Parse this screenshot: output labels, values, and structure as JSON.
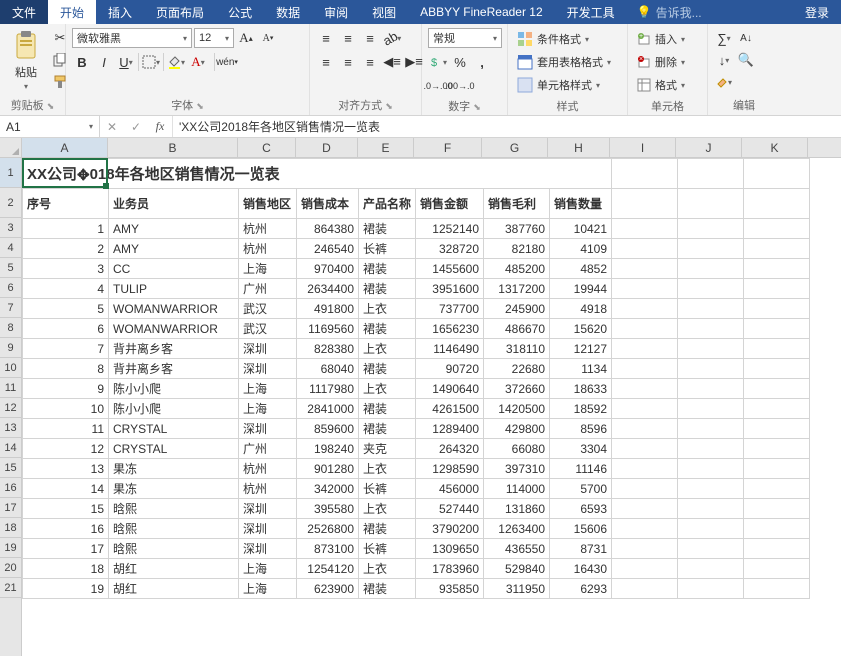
{
  "menu": {
    "file": "文件",
    "tabs": [
      "开始",
      "插入",
      "页面布局",
      "公式",
      "数据",
      "审阅",
      "视图",
      "ABBYY FineReader 12",
      "开发工具"
    ],
    "tellme": "告诉我...",
    "login": "登录"
  },
  "ribbon": {
    "clipboard": {
      "label": "剪贴板",
      "paste": "粘贴"
    },
    "font": {
      "label": "字体",
      "name": "微软雅黑",
      "size": "12"
    },
    "align": {
      "label": "对齐方式"
    },
    "number": {
      "label": "数字",
      "format": "常规"
    },
    "styles": {
      "label": "样式",
      "cond": "条件格式",
      "table": "套用表格格式",
      "cell": "单元格样式"
    },
    "cells": {
      "label": "单元格",
      "insert": "插入",
      "delete": "删除",
      "format": "格式"
    },
    "editing": {
      "label": "编辑"
    }
  },
  "fbar": {
    "name": "A1",
    "formula": "'XX公司2018年各地区销售情况一览表"
  },
  "cols": [
    "A",
    "B",
    "C",
    "D",
    "E",
    "F",
    "G",
    "H",
    "I",
    "J",
    "K"
  ],
  "title": "XX公司2018年各地区销售情况一览表",
  "title_cursor": "XX公司⼿018年各地区销售情况一览表",
  "headers": [
    "序号",
    "业务员",
    "销售地区",
    "销售成本",
    "产品名称",
    "销售金额",
    "销售毛利",
    "销售数量"
  ],
  "rows": [
    {
      "n": 1,
      "a": "AMY",
      "r": "杭州",
      "cost": 864380,
      "p": "裙装",
      "amt": 1252140,
      "gp": 387760,
      "q": 10421
    },
    {
      "n": 2,
      "a": "AMY",
      "r": "杭州",
      "cost": 246540,
      "p": "长裤",
      "amt": 328720,
      "gp": 82180,
      "q": 4109
    },
    {
      "n": 3,
      "a": "CC",
      "r": "上海",
      "cost": 970400,
      "p": "裙装",
      "amt": 1455600,
      "gp": 485200,
      "q": 4852
    },
    {
      "n": 4,
      "a": "TULIP",
      "r": "广州",
      "cost": 2634400,
      "p": "裙装",
      "amt": 3951600,
      "gp": 1317200,
      "q": 19944
    },
    {
      "n": 5,
      "a": "WOMANWARRIOR",
      "r": "武汉",
      "cost": 491800,
      "p": "上衣",
      "amt": 737700,
      "gp": 245900,
      "q": 4918
    },
    {
      "n": 6,
      "a": "WOMANWARRIOR",
      "r": "武汉",
      "cost": 1169560,
      "p": "裙装",
      "amt": 1656230,
      "gp": 486670,
      "q": 15620
    },
    {
      "n": 7,
      "a": "背井离乡客",
      "r": "深圳",
      "cost": 828380,
      "p": "上衣",
      "amt": 1146490,
      "gp": 318110,
      "q": 12127
    },
    {
      "n": 8,
      "a": "背井离乡客",
      "r": "深圳",
      "cost": 68040,
      "p": "裙装",
      "amt": 90720,
      "gp": 22680,
      "q": 1134
    },
    {
      "n": 9,
      "a": "陈小小爬",
      "r": "上海",
      "cost": 1117980,
      "p": "上衣",
      "amt": 1490640,
      "gp": 372660,
      "q": 18633
    },
    {
      "n": 10,
      "a": "陈小小爬",
      "r": "上海",
      "cost": 2841000,
      "p": "裙装",
      "amt": 4261500,
      "gp": 1420500,
      "q": 18592
    },
    {
      "n": 11,
      "a": "CRYSTAL",
      "r": "深圳",
      "cost": 859600,
      "p": "裙装",
      "amt": 1289400,
      "gp": 429800,
      "q": 8596
    },
    {
      "n": 12,
      "a": "CRYSTAL",
      "r": "广州",
      "cost": 198240,
      "p": "夹克",
      "amt": 264320,
      "gp": 66080,
      "q": 3304
    },
    {
      "n": 13,
      "a": "果冻",
      "r": "杭州",
      "cost": 901280,
      "p": "上衣",
      "amt": 1298590,
      "gp": 397310,
      "q": 11146
    },
    {
      "n": 14,
      "a": "果冻",
      "r": "杭州",
      "cost": 342000,
      "p": "长裤",
      "amt": 456000,
      "gp": 114000,
      "q": 5700
    },
    {
      "n": 15,
      "a": "晗熙",
      "r": "深圳",
      "cost": 395580,
      "p": "上衣",
      "amt": 527440,
      "gp": 131860,
      "q": 6593
    },
    {
      "n": 16,
      "a": "晗熙",
      "r": "深圳",
      "cost": 2526800,
      "p": "裙装",
      "amt": 3790200,
      "gp": 1263400,
      "q": 15606
    },
    {
      "n": 17,
      "a": "晗熙",
      "r": "深圳",
      "cost": 873100,
      "p": "长裤",
      "amt": 1309650,
      "gp": 436550,
      "q": 8731
    },
    {
      "n": 18,
      "a": "胡红",
      "r": "上海",
      "cost": 1254120,
      "p": "上衣",
      "amt": 1783960,
      "gp": 529840,
      "q": 16430
    },
    {
      "n": 19,
      "a": "胡红",
      "r": "上海",
      "cost": 623900,
      "p": "裙装",
      "amt": 935850,
      "gp": 311950,
      "q": 6293
    }
  ]
}
